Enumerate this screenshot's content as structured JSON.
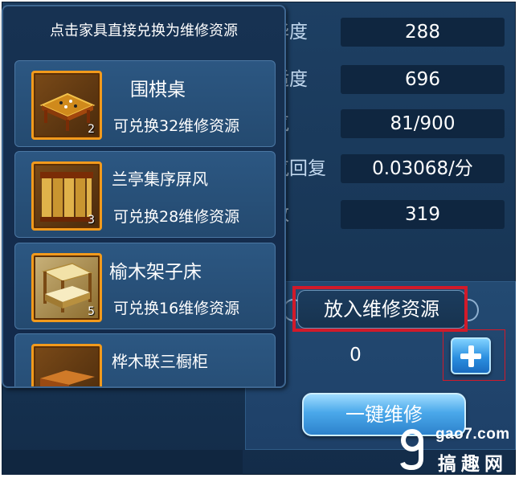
{
  "stats": [
    {
      "name": "豪华度",
      "value": "288"
    },
    {
      "name": "舒适度",
      "value": "696"
    },
    {
      "name": "灵气",
      "value": "81/900"
    },
    {
      "name": "灵气回复",
      "value": "0.03068/分"
    },
    {
      "name": "气数",
      "value": "319"
    }
  ],
  "repair_panel": {
    "title": "放入维修资源",
    "amount": "0",
    "add_icon": "plus-icon",
    "repair_all_label": "一键维修"
  },
  "popup": {
    "header": "点击家具直接兑换为维修资源",
    "items": [
      {
        "name": "围棋桌",
        "count": "2",
        "desc": "可兑换32维修资源"
      },
      {
        "name": "兰亭集序屏风",
        "count": "3",
        "desc": "可兑换28维修资源"
      },
      {
        "name": "榆木架子床",
        "count": "5",
        "desc": "可兑换16维修资源"
      },
      {
        "name": "桦木联三橱柜",
        "count": "",
        "desc": ""
      }
    ]
  },
  "watermark": {
    "site": "gao7.com",
    "name": "搞趣网"
  },
  "colors": {
    "highlight": "#d11a2a",
    "item_border": "#f29a1c",
    "panel_bg": "#183656"
  }
}
